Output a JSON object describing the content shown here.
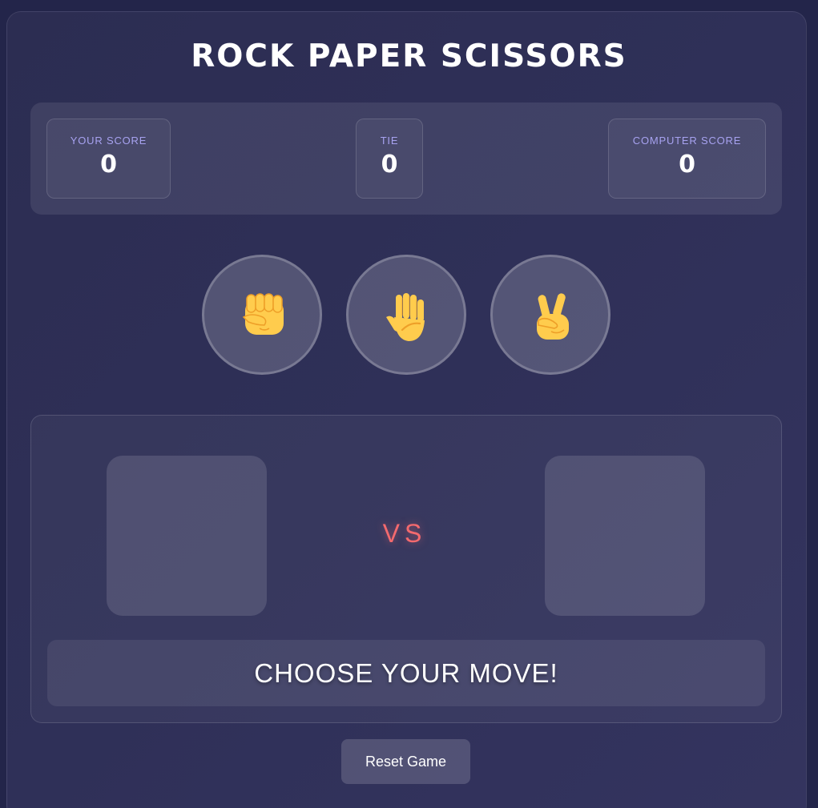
{
  "title": "ROCK PAPER SCISSORS",
  "scores": {
    "player": {
      "label": "YOUR SCORE",
      "value": "0"
    },
    "tie": {
      "label": "TIE",
      "value": "0"
    },
    "computer": {
      "label": "COMPUTER SCORE",
      "value": "0"
    }
  },
  "moves": [
    {
      "name": "rock",
      "icon": "raised-fist-icon"
    },
    {
      "name": "paper",
      "icon": "raised-hand-icon"
    },
    {
      "name": "scissors",
      "icon": "victory-hand-icon"
    }
  ],
  "battle": {
    "vs_label": "VS",
    "player_choice": "",
    "computer_choice": "",
    "result_message": "CHOOSE YOUR MOVE!"
  },
  "reset_label": "Reset Game",
  "colors": {
    "background": "#23254a",
    "score_label": "#a7a2f0",
    "vs": "#f46a6e",
    "emoji_yellow": "#ffcc4d",
    "emoji_shade": "#ee9f28"
  }
}
